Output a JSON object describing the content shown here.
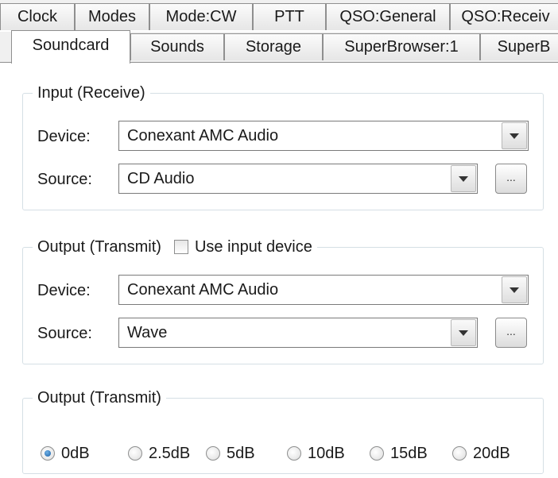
{
  "tabs_back": [
    {
      "label": "Clock"
    },
    {
      "label": "Modes"
    },
    {
      "label": "Mode:CW"
    },
    {
      "label": "PTT"
    },
    {
      "label": "QSO:General"
    },
    {
      "label": "QSO:Receiv"
    }
  ],
  "tabs_front": [
    {
      "label": "Soundcard",
      "active": true
    },
    {
      "label": "Sounds"
    },
    {
      "label": "Storage"
    },
    {
      "label": "SuperBrowser:1"
    },
    {
      "label": "SuperB"
    }
  ],
  "input_group": {
    "title": "Input (Receive)",
    "device_label": "Device:",
    "device_value": "Conexant AMC Audio",
    "source_label": "Source:",
    "source_value": "CD Audio",
    "browse_label": "..."
  },
  "output_group": {
    "title": "Output (Transmit)",
    "use_input_label": "Use input device",
    "use_input_checked": false,
    "device_label": "Device:",
    "device_value": "Conexant AMC Audio",
    "source_label": "Source:",
    "source_value": "Wave",
    "browse_label": "..."
  },
  "level_group": {
    "title": "Output (Transmit)",
    "options": [
      {
        "label": "0dB",
        "selected": true
      },
      {
        "label": "2.5dB",
        "selected": false
      },
      {
        "label": "5dB",
        "selected": false
      },
      {
        "label": "10dB",
        "selected": false
      },
      {
        "label": "15dB",
        "selected": false
      },
      {
        "label": "20dB",
        "selected": false
      }
    ]
  },
  "colors": {
    "tab_border": "#8f8f8f",
    "group_border": "#d5dfe5",
    "radio_selected": "#1b5fa5"
  }
}
